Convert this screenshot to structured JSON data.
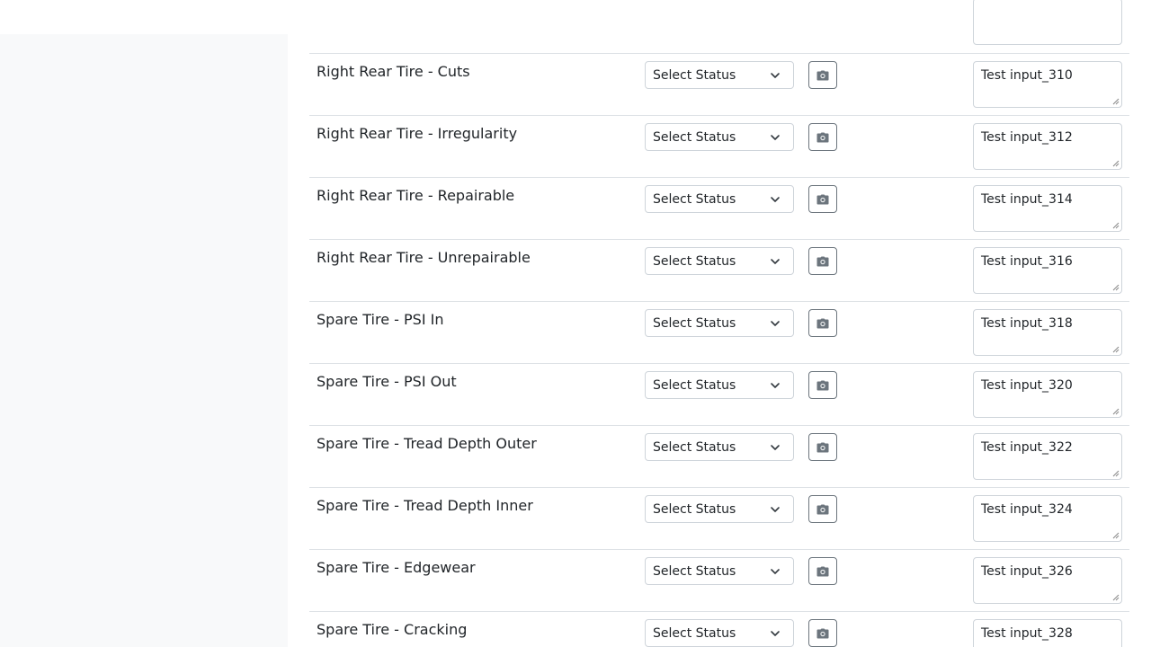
{
  "rows": [
    {
      "label": "",
      "status": "",
      "notes": ""
    },
    {
      "label": "Right Rear Tire - Cuts",
      "status": "Select Status",
      "notes": "Test input_310"
    },
    {
      "label": "Right Rear Tire - Irregularity",
      "status": "Select Status",
      "notes": "Test input_312"
    },
    {
      "label": "Right Rear Tire - Repairable",
      "status": "Select Status",
      "notes": "Test input_314"
    },
    {
      "label": "Right Rear Tire - Unrepairable",
      "status": "Select Status",
      "notes": "Test input_316"
    },
    {
      "label": "Spare Tire - PSI In",
      "status": "Select Status",
      "notes": "Test input_318"
    },
    {
      "label": "Spare Tire - PSI Out",
      "status": "Select Status",
      "notes": "Test input_320"
    },
    {
      "label": "Spare Tire - Tread Depth Outer",
      "status": "Select Status",
      "notes": "Test input_322"
    },
    {
      "label": "Spare Tire - Tread Depth Inner",
      "status": "Select Status",
      "notes": "Test input_324"
    },
    {
      "label": "Spare Tire - Edgewear",
      "status": "Select Status",
      "notes": "Test input_326"
    },
    {
      "label": "Spare Tire - Cracking",
      "status": "Select Status",
      "notes": "Test input_328"
    }
  ],
  "icons": {
    "select": "chevron-down-icon",
    "photo": "camera-icon"
  }
}
